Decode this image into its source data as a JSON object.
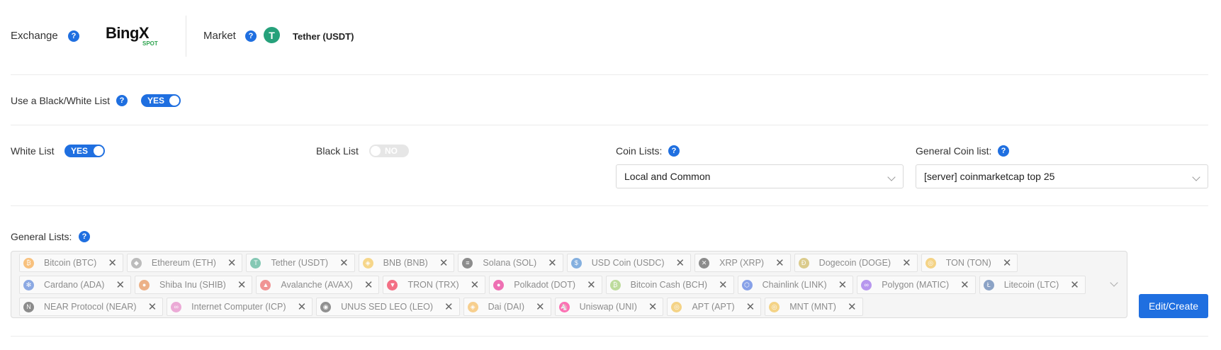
{
  "exchange": {
    "label": "Exchange",
    "logo_text": "BingX",
    "logo_sub": "SPOT"
  },
  "market": {
    "label": "Market",
    "value": "Tether (USDT)",
    "icon": "tether-icon",
    "icon_color": "#26a17b"
  },
  "bw_list": {
    "label": "Use a Black/White List",
    "toggle": "YES"
  },
  "white_list": {
    "label": "White List",
    "toggle": "YES"
  },
  "black_list": {
    "label": "Black List",
    "toggle": "NO"
  },
  "coin_lists": {
    "label": "Coin Lists:",
    "value": "Local and Common"
  },
  "general_coin_list": {
    "label": "General Coin list:",
    "value": "[server] coinmarketcap top 25"
  },
  "general_lists": {
    "label": "General Lists:",
    "rows": [
      [
        {
          "name": "Bitcoin (BTC)",
          "color": "#f7931a",
          "glyph": "₿"
        },
        {
          "name": "Ethereum (ETH)",
          "color": "#8a8a8a",
          "glyph": "◆"
        },
        {
          "name": "Tether (USDT)",
          "color": "#26a17b",
          "glyph": "T"
        },
        {
          "name": "BNB (BNB)",
          "color": "#f3ba2f",
          "glyph": "◈"
        },
        {
          "name": "Solana (SOL)",
          "color": "#333333",
          "glyph": "≡"
        },
        {
          "name": "USD Coin (USDC)",
          "color": "#2775ca",
          "glyph": "$"
        },
        {
          "name": "XRP (XRP)",
          "color": "#333333",
          "glyph": "✕"
        },
        {
          "name": "Dogecoin (DOGE)",
          "color": "#c2a633",
          "glyph": "Ð"
        },
        {
          "name": "TON (TON)",
          "color": "#f0b429",
          "glyph": "◎"
        }
      ],
      [
        {
          "name": "Cardano (ADA)",
          "color": "#3468d1",
          "glyph": "✻"
        },
        {
          "name": "Shiba Inu (SHIB)",
          "color": "#e2762b",
          "glyph": "●"
        },
        {
          "name": "Avalanche (AVAX)",
          "color": "#e84142",
          "glyph": "▲"
        },
        {
          "name": "TRON (TRX)",
          "color": "#ef0027",
          "glyph": "▼"
        },
        {
          "name": "Polkadot (DOT)",
          "color": "#e6007a",
          "glyph": "●"
        },
        {
          "name": "Bitcoin Cash (BCH)",
          "color": "#8dc351",
          "glyph": "₿"
        },
        {
          "name": "Chainlink (LINK)",
          "color": "#2a5ada",
          "glyph": "⬡"
        },
        {
          "name": "Polygon (MATIC)",
          "color": "#8247e5",
          "glyph": "∞"
        },
        {
          "name": "Litecoin (LTC)",
          "color": "#345d9d",
          "glyph": "Ł"
        }
      ],
      [
        {
          "name": "NEAR Protocol (NEAR)",
          "color": "#333333",
          "glyph": "N"
        },
        {
          "name": "Internet Computer (ICP)",
          "color": "#e06ab9",
          "glyph": "∞"
        },
        {
          "name": "UNUS SED LEO (LEO)",
          "color": "#3b3b3b",
          "glyph": "◉"
        },
        {
          "name": "Dai (DAI)",
          "color": "#f5ac37",
          "glyph": "◈"
        },
        {
          "name": "Uniswap (UNI)",
          "color": "#ff007a",
          "glyph": "🦄"
        },
        {
          "name": "APT (APT)",
          "color": "#f0b429",
          "glyph": "◎"
        },
        {
          "name": "MNT (MNT)",
          "color": "#f0b429",
          "glyph": "◎"
        }
      ]
    ]
  },
  "edit_button": "Edit/Create"
}
